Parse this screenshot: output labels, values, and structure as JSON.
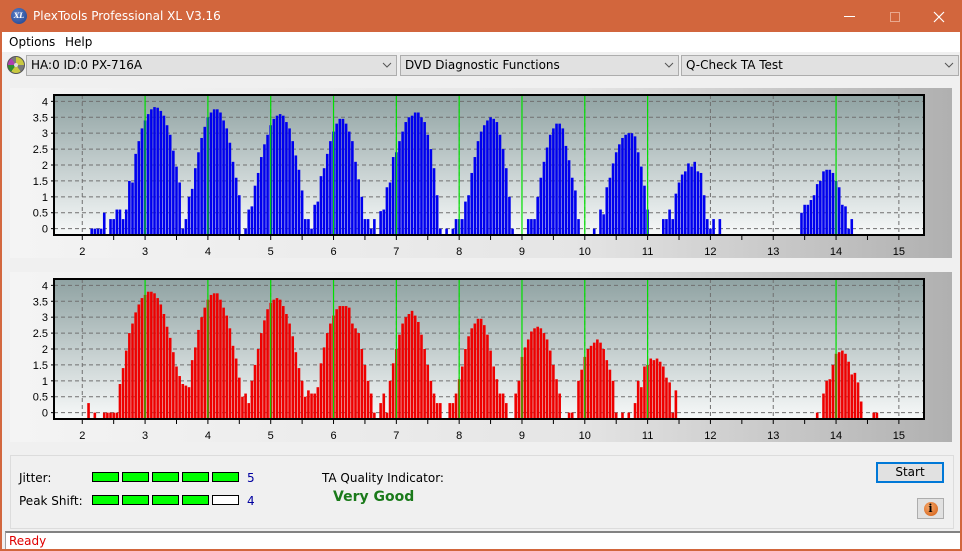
{
  "window": {
    "title": "PlexTools Professional XL V3.16",
    "app_icon": "XL",
    "controls": {
      "minimize": "minimize-icon",
      "maximize": "maximize-icon",
      "close": "close-icon"
    }
  },
  "menu": {
    "items": [
      {
        "label": "Options"
      },
      {
        "label": "Help"
      }
    ]
  },
  "toolbar": {
    "drive": {
      "icon": "disc-drive-icon",
      "value": "HA:0 ID:0  PX-716A"
    },
    "function": {
      "value": "DVD Diagnostic Functions"
    },
    "test": {
      "value": "Q-Check TA Test"
    }
  },
  "colors": {
    "titlebar": "#d2663d",
    "top_bars": "#0000ee",
    "bottom_bars": "#ee0000",
    "reference_lines": "#00e000",
    "quality_text": "#1a7a1a",
    "status_text": "#e00000",
    "meter_on": "#00ff00"
  },
  "chart_data": [
    {
      "type": "bar",
      "name": "top-chart",
      "title": "",
      "xlabel": "",
      "ylabel": "",
      "xlim": [
        1.55,
        15.4
      ],
      "ylim": [
        -0.2,
        4.2
      ],
      "x_ticks": [
        "2",
        "3",
        "4",
        "5",
        "6",
        "7",
        "8",
        "9",
        "10",
        "11",
        "12",
        "13",
        "14",
        "15"
      ],
      "y_ticks": [
        "0",
        "0.5",
        "1",
        "1.5",
        "2",
        "2.5",
        "3",
        "3.5",
        "4"
      ],
      "grid": true,
      "reference_lines_x": [
        3,
        4,
        5,
        6,
        7,
        8,
        9,
        10,
        11,
        14
      ],
      "bar_step": 0.05,
      "series": [
        {
          "name": "blue",
          "start_x": 2.15,
          "values": [
            0,
            0,
            0,
            0,
            0.5,
            -1,
            0.3,
            0.3,
            0.6,
            0.6,
            0.3,
            0.6,
            1.5,
            1.45,
            2.35,
            2.75,
            3.15,
            3.4,
            3.6,
            3.75,
            3.82,
            3.8,
            3.7,
            3.55,
            3.25,
            2.95,
            2.45,
            1.95,
            1.45,
            0,
            0.3,
            1.0,
            1.25,
            1.9,
            2.4,
            2.85,
            3.2,
            3.5,
            3.65,
            3.75,
            3.75,
            3.65,
            3.4,
            3.15,
            2.7,
            2.1,
            1.6,
            1.05,
            -1,
            0,
            0.6,
            0.7,
            1.35,
            1.75,
            2.25,
            2.65,
            2.95,
            3.25,
            3.45,
            3.55,
            3.6,
            3.55,
            3.35,
            3.15,
            2.75,
            2.3,
            1.85,
            1.2,
            0.3,
            0.3,
            0,
            0.75,
            0.85,
            1.65,
            1.9,
            2.35,
            2.75,
            3.05,
            3.3,
            3.45,
            3.45,
            3.3,
            3.05,
            2.75,
            2.1,
            1.55,
            1.0,
            0.3,
            0.3,
            0,
            0.3,
            -1,
            0.55,
            0.6,
            1.3,
            1.45,
            2.25,
            2.4,
            2.75,
            3.05,
            3.35,
            3.5,
            3.55,
            3.65,
            3.65,
            3.5,
            3.35,
            2.95,
            2.5,
            1.9,
            1.05,
            0,
            -1,
            0,
            -1,
            0,
            0.3,
            0.3,
            0.3,
            0.85,
            1.05,
            1.75,
            2.25,
            2.75,
            3.05,
            3.25,
            3.4,
            3.5,
            3.45,
            3.35,
            2.95,
            2.5,
            1.9,
            1.0,
            0,
            -1,
            -1,
            -1,
            -1,
            0.3,
            0.3,
            0.3,
            1.0,
            1.6,
            2.1,
            2.55,
            2.95,
            3.15,
            3.3,
            3.3,
            3.15,
            2.6,
            2.15,
            1.6,
            1.2,
            0.3,
            -1,
            -1,
            -1,
            -1,
            0,
            -1,
            0.6,
            0.45,
            1.3,
            1.6,
            2.05,
            2.4,
            2.65,
            2.85,
            2.95,
            3.0,
            3.0,
            2.9,
            2.4,
            1.95,
            1.35,
            0.6,
            -1,
            -1,
            -1,
            -1,
            0.3,
            0.3,
            0.6,
            0.3,
            1.1,
            1.45,
            1.7,
            1.8,
            2.05,
            1.95,
            2.1,
            1.8,
            1.75,
            1.05,
            0.3,
            0,
            0.3,
            -1,
            0.3
          ]
        },
        {
          "name": "blue-14",
          "start_x": 13.45,
          "values": [
            0.5,
            0.75,
            0.75,
            0.9,
            1.05,
            1.4,
            1.5,
            1.8,
            1.85,
            1.85,
            1.75,
            1.5,
            1.3,
            0.75,
            0.7,
            0,
            0.3
          ]
        }
      ]
    },
    {
      "type": "bar",
      "name": "bottom-chart",
      "title": "",
      "xlabel": "",
      "ylabel": "",
      "xlim": [
        1.55,
        15.4
      ],
      "ylim": [
        -0.2,
        4.2
      ],
      "x_ticks": [
        "2",
        "3",
        "4",
        "5",
        "6",
        "7",
        "8",
        "9",
        "10",
        "11",
        "12",
        "13",
        "14",
        "15"
      ],
      "y_ticks": [
        "0",
        "0.5",
        "1",
        "1.5",
        "2",
        "2.5",
        "3",
        "3.5",
        "4"
      ],
      "grid": true,
      "reference_lines_x": [
        3,
        4,
        5,
        6,
        7,
        8,
        9,
        10,
        11,
        14
      ],
      "bar_step": 0.05,
      "series": [
        {
          "name": "red",
          "start_x": 2.1,
          "values": [
            0.3,
            -1,
            0,
            -1,
            -1,
            0,
            0,
            0,
            0,
            0,
            0.9,
            1.4,
            1.95,
            2.5,
            2.8,
            3.15,
            3.4,
            3.6,
            3.7,
            3.8,
            3.8,
            3.75,
            3.6,
            3.4,
            3.1,
            2.7,
            2.35,
            1.9,
            1.45,
            1.15,
            0.9,
            0.85,
            0.8,
            1.65,
            2.05,
            2.6,
            3.0,
            3.3,
            3.55,
            3.7,
            3.75,
            3.75,
            3.55,
            3.3,
            3.05,
            2.65,
            2.1,
            1.7,
            1.1,
            0.5,
            0.6,
            0.3,
            1.0,
            1.5,
            2.0,
            2.5,
            2.9,
            3.25,
            3.45,
            3.55,
            3.6,
            3.55,
            3.35,
            3.1,
            2.8,
            2.4,
            1.9,
            1.4,
            1.0,
            0.5,
            0.7,
            0.6,
            0.6,
            0.8,
            1.55,
            2.05,
            2.5,
            2.8,
            3.05,
            3.25,
            3.35,
            3.35,
            3.35,
            3.3,
            2.8,
            2.65,
            2.5,
            2.0,
            1.5,
            1.0,
            0.6,
            0,
            -1,
            0.3,
            0.6,
            0,
            1.0,
            1.55,
            2.0,
            2.45,
            2.8,
            3.0,
            3.1,
            3.2,
            3.05,
            2.85,
            2.45,
            2.0,
            1.5,
            1.0,
            0.6,
            0.3,
            0.3,
            -1,
            -1,
            0.3,
            0.3,
            0.6,
            1.05,
            1.45,
            2.0,
            2.4,
            2.65,
            2.8,
            2.95,
            2.95,
            2.75,
            2.45,
            1.95,
            1.45,
            1.05,
            0.6,
            0.6,
            0.3,
            -1,
            -1,
            0.6,
            1.0,
            1.75,
            2.05,
            2.3,
            2.55,
            2.65,
            2.7,
            2.65,
            2.5,
            2.3,
            1.95,
            1.5,
            1.05,
            0.6,
            -1,
            -1,
            0,
            0,
            -1,
            1.0,
            1.35,
            1.75,
            2.0,
            2.1,
            2.2,
            2.3,
            2.2,
            2.0,
            1.65,
            1.35,
            1.0,
            0,
            -1,
            0,
            -1,
            0,
            -1,
            0.3,
            1.0,
            0.8,
            1.45,
            1.5,
            1.7,
            1.65,
            1.7,
            1.6,
            1.45,
            1.1,
            0.95,
            0,
            0.7
          ]
        },
        {
          "name": "red-14",
          "start_x": 13.7,
          "values": [
            0,
            -1,
            0.6,
            1.0,
            1.05,
            1.5,
            1.85,
            1.9,
            1.95,
            1.85,
            1.6,
            1.2,
            1.25,
            0.95,
            0.35,
            -1,
            -1,
            -1,
            0,
            0
          ]
        }
      ]
    }
  ],
  "results": {
    "jitter": {
      "label": "Jitter:",
      "value": "5",
      "level": 5,
      "max": 5
    },
    "peak_shift": {
      "label": "Peak Shift:",
      "value": "4",
      "level": 4,
      "max": 5
    },
    "ta_quality": {
      "label": "TA Quality Indicator:",
      "value": "Very Good"
    }
  },
  "buttons": {
    "start": "Start",
    "info_icon": "info-icon",
    "info_glyph": "i"
  },
  "status": {
    "text": "Ready"
  }
}
